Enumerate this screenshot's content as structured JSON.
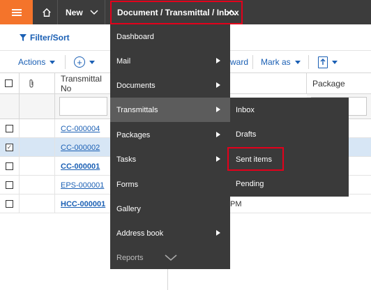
{
  "topbar": {
    "menu_icon": "hamburger-icon",
    "home_icon": "home-icon",
    "new_label": "New",
    "breadcrumb_label": "Document / Transmittal / Inbox"
  },
  "filter_sort": {
    "label": "Filter/Sort",
    "icon": "filter-icon"
  },
  "toolbar": {
    "actions_label": "Actions",
    "add_icon": "plus-circle-icon",
    "forward_partial": "ward",
    "mark_as_label": "Mark as",
    "export_icon": "export-icon"
  },
  "grid": {
    "headers": {
      "transmittal_no": "Transmittal No",
      "package": "Package"
    },
    "rows": [
      {
        "id": "CC-000004",
        "bold": false,
        "checked": false
      },
      {
        "id": "CC-000002",
        "bold": false,
        "checked": true
      },
      {
        "id": "CC-000001",
        "bold": true,
        "checked": false
      },
      {
        "id": "EPS-000001",
        "bold": false,
        "checked": false
      },
      {
        "id": "HCC-000001",
        "bold": true,
        "checked": false
      }
    ],
    "row5_time_partial": "PM"
  },
  "menu": {
    "items": [
      {
        "label": "Dashboard",
        "has_submenu": false
      },
      {
        "label": "Mail",
        "has_submenu": true
      },
      {
        "label": "Documents",
        "has_submenu": true
      },
      {
        "label": "Transmittals",
        "has_submenu": true
      },
      {
        "label": "Packages",
        "has_submenu": true
      },
      {
        "label": "Tasks",
        "has_submenu": true
      },
      {
        "label": "Forms",
        "has_submenu": false
      },
      {
        "label": "Gallery",
        "has_submenu": false
      },
      {
        "label": "Address book",
        "has_submenu": true
      },
      {
        "label": "Reports",
        "has_submenu": false
      }
    ],
    "more_icon": "chevron-down-icon"
  },
  "submenu": {
    "items": [
      {
        "label": "Inbox"
      },
      {
        "label": "Drafts"
      },
      {
        "label": "Sent items"
      },
      {
        "label": "Pending"
      }
    ]
  },
  "colors": {
    "topbar": "#3c3c3c",
    "accent": "#f4742b",
    "highlight": "#e3001b",
    "link": "#1a5fb4",
    "menu_bg": "#3a3a3a",
    "selected_row": "#d7e6f5"
  }
}
